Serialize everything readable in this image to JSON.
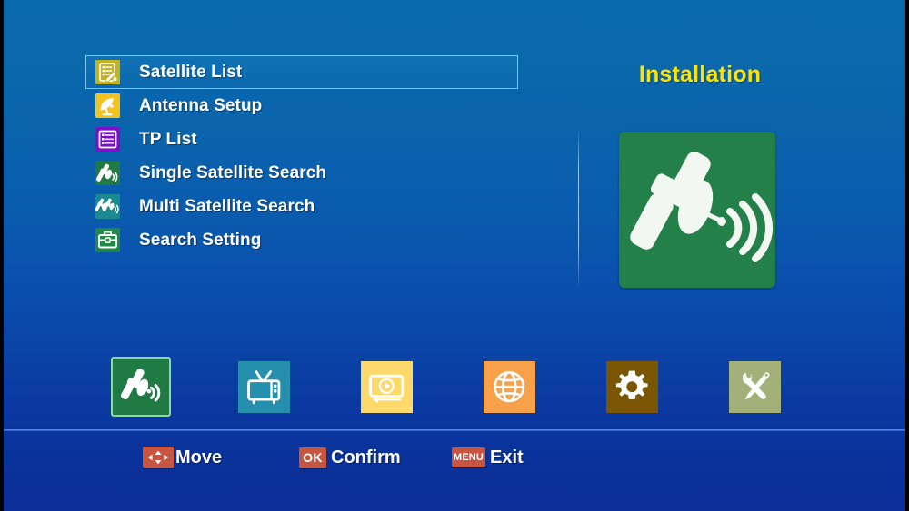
{
  "panel": {
    "title": "Installation",
    "preview_icon": "satellite-dish-icon",
    "preview_bg": "#228048"
  },
  "menu": {
    "items": [
      {
        "label": "Satellite List",
        "icon": "satellite-list-icon",
        "icon_bg": "#c3b323",
        "selected": true
      },
      {
        "label": "Antenna Setup",
        "icon": "antenna-dish-icon",
        "icon_bg": "#f1c220",
        "selected": false
      },
      {
        "label": "TP List",
        "icon": "tp-list-icon",
        "icon_bg": "#7c10c8",
        "selected": false
      },
      {
        "label": "Single Satellite Search",
        "icon": "single-search-icon",
        "icon_bg": "#1f7a43",
        "selected": false
      },
      {
        "label": "Multi Satellite Search",
        "icon": "multi-search-icon",
        "icon_bg": "#1a8a90",
        "selected": false
      },
      {
        "label": "Search Setting",
        "icon": "toolbox-icon",
        "icon_bg": "#1f8a45",
        "selected": false
      }
    ]
  },
  "icon_strip": {
    "items": [
      {
        "name": "installation",
        "icon": "satellite-icon",
        "bg": "#1f7a43",
        "active": true
      },
      {
        "name": "channel",
        "icon": "tv-icon",
        "bg": "#2590ad",
        "active": false
      },
      {
        "name": "media",
        "icon": "media-play-icon",
        "bg": "#fcd96a",
        "active": false
      },
      {
        "name": "network",
        "icon": "globe-icon",
        "bg": "#f7a24b",
        "active": false
      },
      {
        "name": "settings",
        "icon": "gear-icon",
        "bg": "#7a5504",
        "active": false
      },
      {
        "name": "tools",
        "icon": "tools-icon",
        "bg": "#a3b07a",
        "active": false
      }
    ]
  },
  "footer": {
    "hints": [
      {
        "key": "arrows",
        "key_text": "",
        "label": "Move"
      },
      {
        "key": "ok",
        "key_text": "OK",
        "label": "Confirm"
      },
      {
        "key": "menu",
        "key_text": "MENU",
        "label": "Exit"
      }
    ]
  },
  "colors": {
    "accent_yellow": "#ffe400",
    "key_badge": "#c8553f",
    "selected_row_border": "#7fc4ec",
    "background_top": "#0a69ab",
    "background_bottom": "#0b2e97"
  }
}
